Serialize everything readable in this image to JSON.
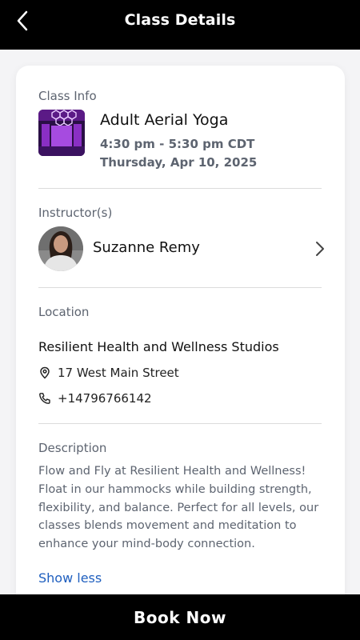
{
  "header": {
    "title": "Class Details"
  },
  "class_info": {
    "label": "Class Info",
    "name": "Adult Aerial Yoga",
    "time": "4:30 pm - 5:30 pm CDT",
    "date": "Thursday, Apr 10, 2025"
  },
  "instructor": {
    "label": "Instructor(s)",
    "name": "Suzanne Remy"
  },
  "location": {
    "label": "Location",
    "name": "Resilient Health and Wellness Studios",
    "address": "17 West Main Street",
    "phone": "+14796766142"
  },
  "description": {
    "label": "Description",
    "text": "Flow and Fly at Resilient Health and Wellness! Float in our hammocks while building strength, flexibility, and balance. Perfect for all levels, our classes blends movement and meditation to enhance your mind-body connection.",
    "toggle": "Show less"
  },
  "footer": {
    "book_label": "Book Now"
  },
  "colors": {
    "accent_link": "#1f5fbf",
    "header_bg": "#000000",
    "muted_text": "#5d6470"
  }
}
